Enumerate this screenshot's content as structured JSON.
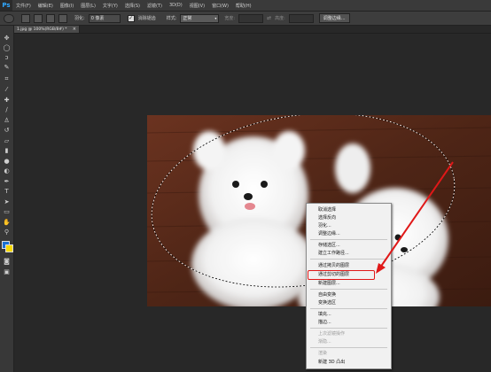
{
  "app": {
    "logo": "Ps"
  },
  "menubar": {
    "items": [
      "文件(F)",
      "编辑(E)",
      "图像(I)",
      "图层(L)",
      "文字(Y)",
      "选择(S)",
      "滤镜(T)",
      "3D(D)",
      "视图(V)",
      "窗口(W)",
      "帮助(H)"
    ]
  },
  "options": {
    "feather_label": "羽化:",
    "feather_value": "0 像素",
    "antialias_label": "消除锯齿",
    "style_label": "样式:",
    "style_value": "正常",
    "width_label": "宽度:",
    "height_label": "高度:",
    "refine_edge_label": "调整边缘..."
  },
  "document": {
    "tab_title": "1.jpg @ 100%(RGB/8#) *",
    "close_glyph": "×"
  },
  "context_menu": {
    "items": [
      {
        "label": "取消选择",
        "disabled": false
      },
      {
        "label": "选择反向",
        "disabled": false
      },
      {
        "label": "羽化...",
        "disabled": false
      },
      {
        "label": "调整边缘...",
        "disabled": false
      },
      {
        "label": "存储选区...",
        "disabled": false
      },
      {
        "label": "建立工作路径...",
        "disabled": false
      },
      {
        "label": "通过拷贝的图层",
        "disabled": false
      },
      {
        "label": "通过剪切的图层",
        "disabled": false
      },
      {
        "label": "新建图层...",
        "disabled": false
      },
      {
        "label": "自由变换",
        "disabled": false
      },
      {
        "label": "变换选区",
        "disabled": false
      },
      {
        "label": "填充...",
        "disabled": false
      },
      {
        "label": "描边...",
        "disabled": false
      },
      {
        "label": "上次滤镜操作",
        "disabled": true
      },
      {
        "label": "渐隐...",
        "disabled": true
      },
      {
        "label": "渲染",
        "disabled": true
      },
      {
        "label": "新建 3D 凸出",
        "disabled": false
      }
    ],
    "highlighted_item": "通过剪切的图层",
    "highlight_color": "#e01818"
  },
  "colors": {
    "accent": "#31a8ff",
    "annotation": "#e01818",
    "wood": "#5a2a1a"
  },
  "icons": {
    "toolbox": [
      "move-icon",
      "marquee-icon",
      "lasso-icon",
      "quick-select-icon",
      "crop-icon",
      "eyedropper-icon",
      "healing-brush-icon",
      "brush-icon",
      "clone-stamp-icon",
      "history-brush-icon",
      "eraser-icon",
      "gradient-icon",
      "blur-icon",
      "dodge-icon",
      "pen-icon",
      "type-icon",
      "path-select-icon",
      "shape-icon",
      "hand-icon",
      "zoom-icon",
      "foreground-color-icon",
      "quick-mask-icon",
      "screen-mode-icon"
    ]
  }
}
